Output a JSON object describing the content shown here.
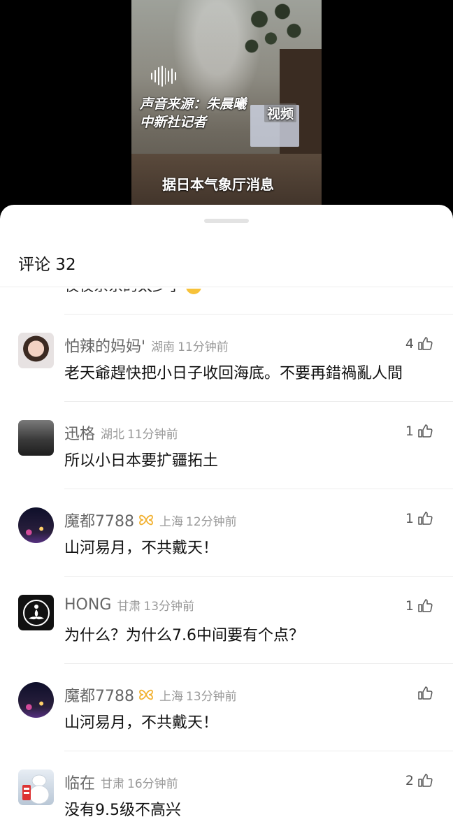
{
  "video": {
    "source_caption": "声音来源：朱晨曦",
    "reporter_caption": "中新社记者",
    "watermark": "视频",
    "subtitle": "据日本气象厅消息"
  },
  "sheet": {
    "title": "评论 32",
    "partial_comment": "夜夜系系的太少了"
  },
  "comments": [
    {
      "name": "怕辣的妈妈'",
      "location": "湖南",
      "time": "11分钟前",
      "likes": "4",
      "text": "老天爺趕快把小日子收回海底。不要再錯禍亂人間",
      "avatar": "woman-portrait",
      "badge": false
    },
    {
      "name": "迅格",
      "location": "湖北",
      "time": "11分钟前",
      "likes": "1",
      "text": "所以小日本要扩疆拓土",
      "avatar": "car-photo",
      "badge": false
    },
    {
      "name": "魔都7788",
      "location": "上海",
      "time": "12分钟前",
      "likes": "1",
      "text": "山河易月，不共戴天！",
      "avatar": "city-night",
      "badge": true
    },
    {
      "name": "HONG",
      "location": "甘肃",
      "time": "13分钟前",
      "likes": "1",
      "text": "为什么？为什么7.6中间要有个点？",
      "avatar": "meditation-logo",
      "badge": false
    },
    {
      "name": "魔都7788",
      "location": "上海",
      "time": "13分钟前",
      "likes": "",
      "text": "山河易月，不共戴天！",
      "avatar": "city-night",
      "badge": true
    },
    {
      "name": "临在",
      "location": "甘肃",
      "time": "16分钟前",
      "likes": "2",
      "text": "没有9.5级不高兴",
      "avatar": "robot-figure",
      "badge": false
    }
  ],
  "colors": {
    "badge": "#f2b233",
    "meta_text": "#999999",
    "name_text": "#666666"
  }
}
